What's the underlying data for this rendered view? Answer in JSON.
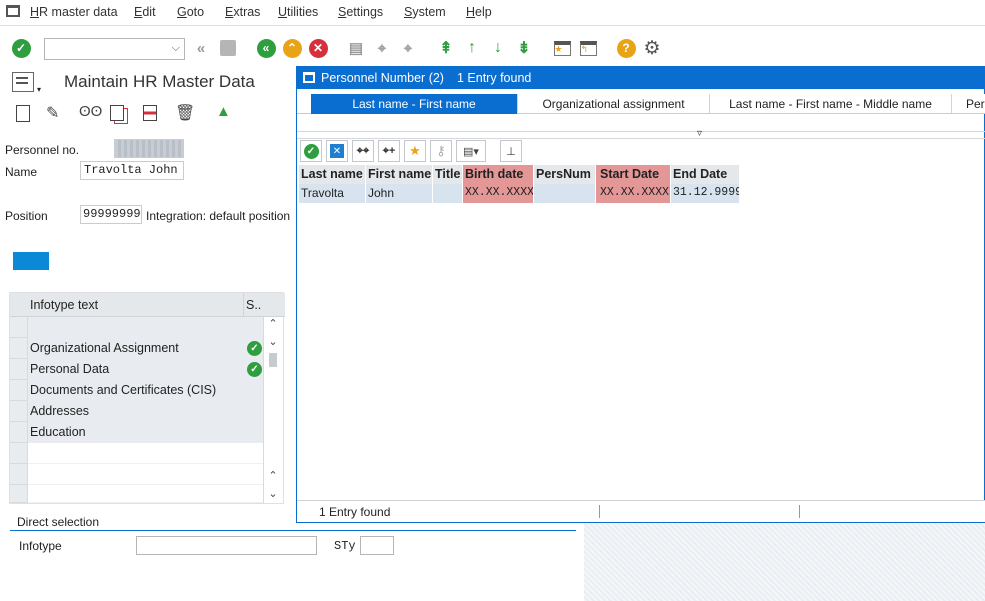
{
  "menu": [
    "HR master data",
    "Edit",
    "Goto",
    "Extras",
    "Utilities",
    "Settings",
    "System",
    "Help"
  ],
  "toolbar": {
    "command_value": "",
    "icons": [
      "enter-icon",
      "back-icon",
      "exit-icon",
      "cancel-icon",
      "print-icon",
      "find-icon",
      "find-next-icon",
      "first-page-icon",
      "previous-page-icon",
      "next-page-icon",
      "last-page-icon",
      "create-session-icon",
      "shortcut-icon",
      "help-icon",
      "settings-icon"
    ]
  },
  "main": {
    "title": "Maintain HR Master Data",
    "personnel_no_label": "Personnel no.",
    "personnel_no_value": "",
    "name_label": "Name",
    "name_value": "Travolta John",
    "position_label": "Position",
    "position_value": "99999999",
    "position_text": "Integration: default position"
  },
  "infotypes": {
    "header_text": "Infotype text",
    "header_status": "S..",
    "items": [
      {
        "label": "",
        "status": ""
      },
      {
        "label": "Organizational Assignment",
        "status": "done"
      },
      {
        "label": "Personal Data",
        "status": "done"
      },
      {
        "label": "Documents and Certificates (CIS)",
        "status": ""
      },
      {
        "label": "Addresses",
        "status": ""
      },
      {
        "label": "Education",
        "status": ""
      }
    ]
  },
  "direct_selection": {
    "title": "Direct selection",
    "infotype_label": "Infotype",
    "infotype_value": "",
    "sty_label": "STy",
    "sty_value": ""
  },
  "popup": {
    "title": "Personnel Number (2)",
    "entries_found": "1 Entry found",
    "tabs": [
      "Last name - First name",
      "Organizational assignment",
      "Last name - First name - Middle name",
      "Pers"
    ],
    "columns": [
      "Last name",
      "First name",
      "Title",
      "Birth date",
      "PersNum",
      "Start Date",
      "End Date"
    ],
    "rows": [
      [
        "Travolta",
        "John",
        "",
        "XX.XX.XXXX",
        "",
        "XX.XX.XXXX",
        "31.12.9999"
      ]
    ],
    "status_text": "1 Entry found"
  },
  "colors": {
    "accent": "#0a6ed1",
    "highlight_red": "#e49797",
    "ok_green": "#2e9e3e"
  }
}
